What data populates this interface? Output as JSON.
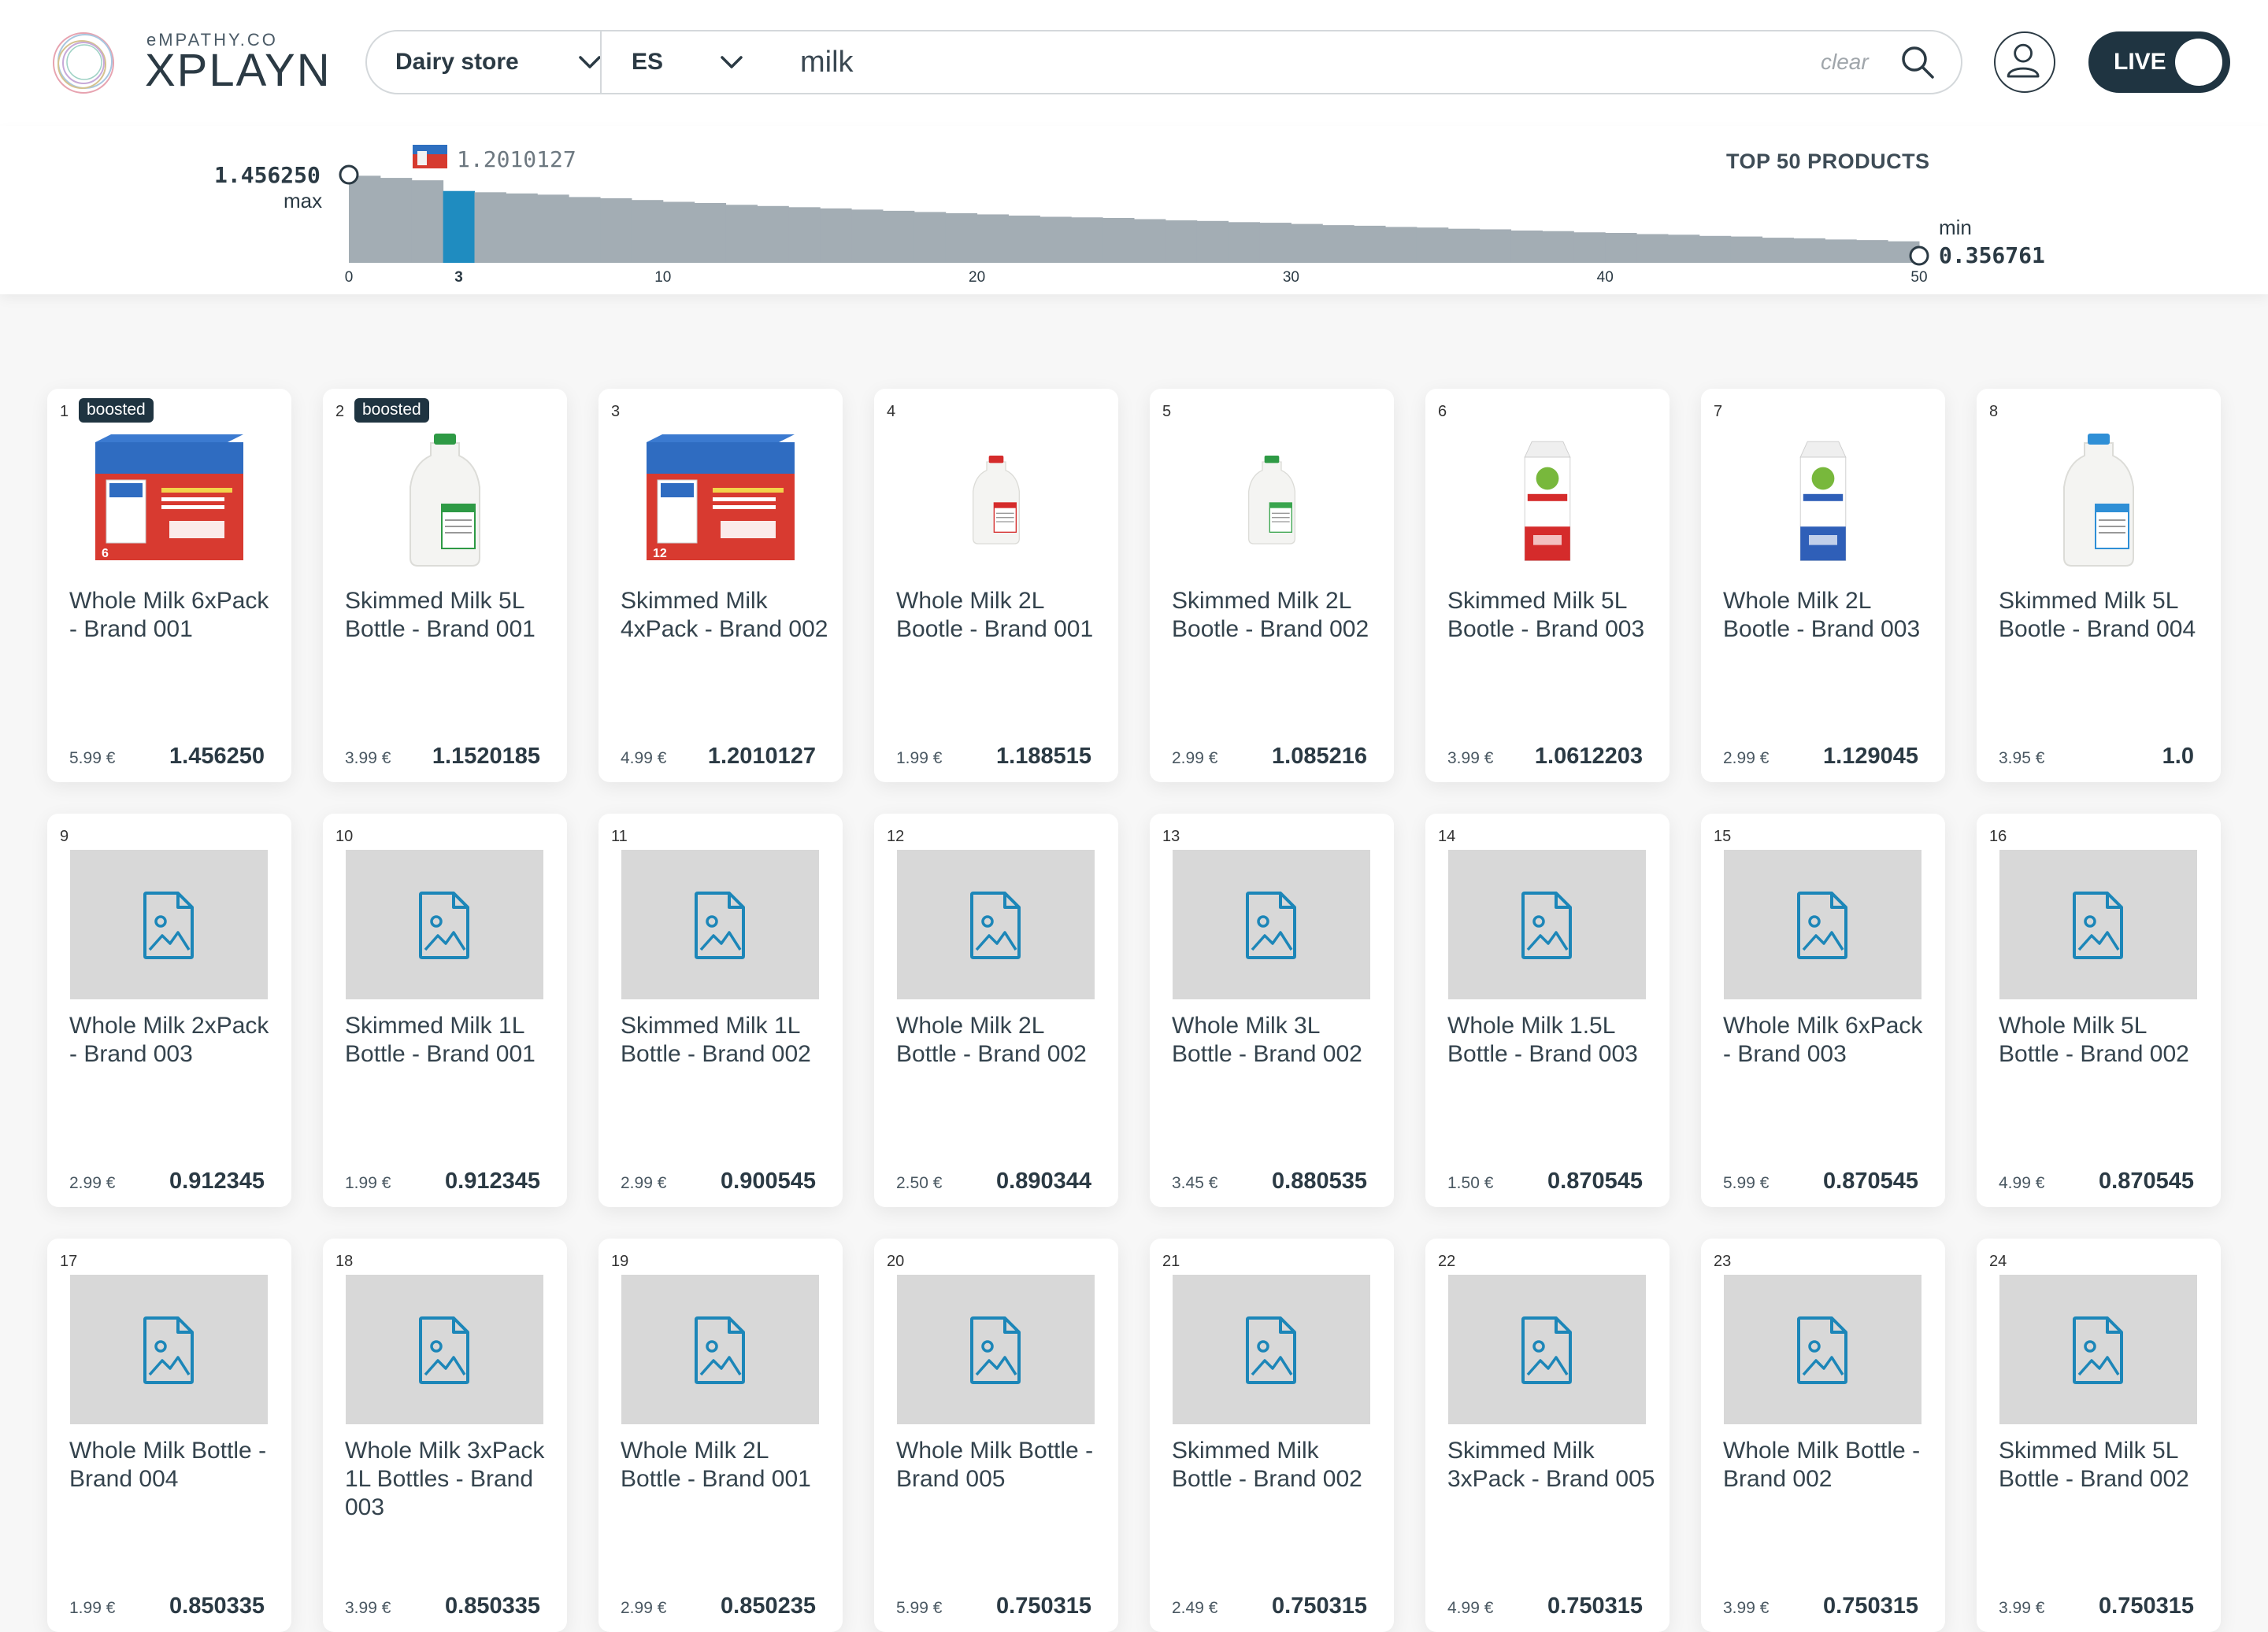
{
  "brand": {
    "top": "eMPATHY.CO",
    "name": "XPLAYN"
  },
  "search": {
    "store": "Dairy store",
    "language": "ES",
    "query": "milk",
    "clear_label": "clear"
  },
  "live_toggle": {
    "label": "LIVE",
    "on": true
  },
  "chart_data": {
    "type": "bar",
    "title": "TOP 50 PRODUCTS",
    "x_ticks": [
      "0",
      "3",
      "10",
      "20",
      "30",
      "40",
      "50"
    ],
    "max": {
      "label": "max",
      "value": "1.456250"
    },
    "min": {
      "label": "min",
      "value": "0.356761"
    },
    "highlight": {
      "index": 3,
      "value": "1.2010127"
    },
    "values": [
      1.456,
      1.42,
      1.38,
      1.201,
      1.18,
      1.16,
      1.14,
      1.1,
      1.08,
      1.05,
      1.02,
      1.0,
      0.97,
      0.95,
      0.93,
      0.91,
      0.89,
      0.87,
      0.85,
      0.83,
      0.81,
      0.79,
      0.77,
      0.76,
      0.75,
      0.73,
      0.71,
      0.7,
      0.68,
      0.67,
      0.65,
      0.63,
      0.62,
      0.6,
      0.59,
      0.57,
      0.56,
      0.54,
      0.53,
      0.51,
      0.5,
      0.48,
      0.47,
      0.45,
      0.44,
      0.42,
      0.41,
      0.39,
      0.38,
      0.36
    ],
    "colors": {
      "bar": "#a3adb4",
      "highlight": "#1f8cc0"
    }
  },
  "products": [
    {
      "rank": "1",
      "boosted": "boosted",
      "title": "Whole Milk 6xPack - Brand 001",
      "price": "5.99 €",
      "score": "1.456250",
      "image": "milk-box-6pack"
    },
    {
      "rank": "2",
      "boosted": "boosted",
      "title": "Skimmed Milk 5L Bottle - Brand 001",
      "price": "3.99 €",
      "score": "1.1520185",
      "image": "jug-green"
    },
    {
      "rank": "3",
      "boosted": "",
      "title": "Skimmed Milk 4xPack - Brand 002",
      "price": "4.99 €",
      "score": "1.2010127",
      "image": "milk-box-12pack"
    },
    {
      "rank": "4",
      "boosted": "",
      "title": "Whole Milk 2L Bootle - Brand 001",
      "price": "1.99 €",
      "score": "1.188515",
      "image": "jug-red"
    },
    {
      "rank": "5",
      "boosted": "",
      "title": "Skimmed Milk 2L Bootle - Brand 002",
      "price": "2.99 €",
      "score": "1.085216",
      "image": "jug-green-small"
    },
    {
      "rank": "6",
      "boosted": "",
      "title": "Skimmed Milk 5L Bootle - Brand 003",
      "price": "3.99 €",
      "score": "1.0612203",
      "image": "carton-red"
    },
    {
      "rank": "7",
      "boosted": "",
      "title": "Whole Milk 2L Bootle - Brand 003",
      "price": "2.99 €",
      "score": "1.129045",
      "image": "carton-blue"
    },
    {
      "rank": "8",
      "boosted": "",
      "title": "Skimmed Milk 5L Bootle - Brand 004",
      "price": "3.95 €",
      "score": "1.0",
      "image": "jug-blue"
    },
    {
      "rank": "9",
      "boosted": "",
      "title": "Whole Milk 2xPack - Brand 003",
      "price": "2.99 €",
      "score": "0.912345",
      "image": "placeholder"
    },
    {
      "rank": "10",
      "boosted": "",
      "title": "Skimmed Milk 1L Bottle - Brand 001",
      "price": "1.99 €",
      "score": "0.912345",
      "image": "placeholder"
    },
    {
      "rank": "11",
      "boosted": "",
      "title": "Skimmed Milk 1L Bottle - Brand 002",
      "price": "2.99 €",
      "score": "0.900545",
      "image": "placeholder"
    },
    {
      "rank": "12",
      "boosted": "",
      "title": "Whole Milk 2L Bottle - Brand 002",
      "price": "2.50 €",
      "score": "0.890344",
      "image": "placeholder"
    },
    {
      "rank": "13",
      "boosted": "",
      "title": "Whole Milk 3L Bottle - Brand 002",
      "price": "3.45 €",
      "score": "0.880535",
      "image": "placeholder"
    },
    {
      "rank": "14",
      "boosted": "",
      "title": "Whole Milk 1.5L Bottle - Brand 003",
      "price": "1.50 €",
      "score": "0.870545",
      "image": "placeholder"
    },
    {
      "rank": "15",
      "boosted": "",
      "title": "Whole Milk 6xPack - Brand 003",
      "price": "5.99 €",
      "score": "0.870545",
      "image": "placeholder"
    },
    {
      "rank": "16",
      "boosted": "",
      "title": "Whole Milk 5L Bottle - Brand 002",
      "price": "4.99 €",
      "score": "0.870545",
      "image": "placeholder"
    },
    {
      "rank": "17",
      "boosted": "",
      "title": "Whole Milk Bottle - Brand 004",
      "price": "1.99 €",
      "score": "0.850335",
      "image": "placeholder"
    },
    {
      "rank": "18",
      "boosted": "",
      "title": "Whole Milk 3xPack 1L Bottles - Brand 003",
      "price": "3.99 €",
      "score": "0.850335",
      "image": "placeholder"
    },
    {
      "rank": "19",
      "boosted": "",
      "title": "Whole Milk 2L Bottle - Brand 001",
      "price": "2.99 €",
      "score": "0.850235",
      "image": "placeholder"
    },
    {
      "rank": "20",
      "boosted": "",
      "title": "Whole Milk Bottle - Brand 005",
      "price": "5.99 €",
      "score": "0.750315",
      "image": "placeholder"
    },
    {
      "rank": "21",
      "boosted": "",
      "title": "Skimmed Milk Bottle - Brand 002",
      "price": "2.49 €",
      "score": "0.750315",
      "image": "placeholder"
    },
    {
      "rank": "22",
      "boosted": "",
      "title": "Skimmed Milk 3xPack - Brand 005",
      "price": "4.99 €",
      "score": "0.750315",
      "image": "placeholder"
    },
    {
      "rank": "23",
      "boosted": "",
      "title": "Whole Milk Bottle - Brand 002",
      "price": "3.99 €",
      "score": "0.750315",
      "image": "placeholder"
    },
    {
      "rank": "24",
      "boosted": "",
      "title": "Skimmed Milk 5L Bottle - Brand 002",
      "price": "3.99 €",
      "score": "0.750315",
      "image": "placeholder"
    }
  ]
}
